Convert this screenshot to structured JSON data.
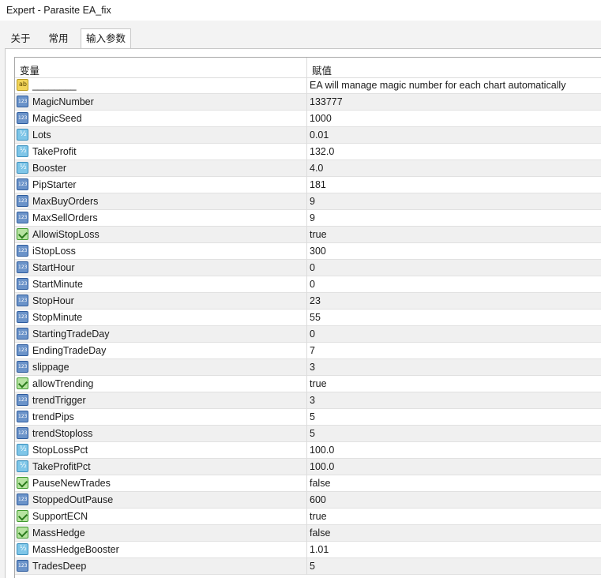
{
  "window": {
    "title": "Expert - Parasite EA_fix"
  },
  "tabs": [
    {
      "label": "关于"
    },
    {
      "label": "常用"
    },
    {
      "label": "输入参数",
      "active": true
    }
  ],
  "table": {
    "headers": {
      "variable": "变量",
      "value": "赋值"
    },
    "rows": [
      {
        "icon": "string-icon",
        "name": "________",
        "value": "EA will manage magic number for each chart automatically"
      },
      {
        "icon": "integer-icon",
        "name": "MagicNumber",
        "value": "133777"
      },
      {
        "icon": "integer-icon",
        "name": "MagicSeed",
        "value": "1000"
      },
      {
        "icon": "double-icon",
        "name": "Lots",
        "value": "0.01"
      },
      {
        "icon": "double-icon",
        "name": "TakeProfit",
        "value": "132.0"
      },
      {
        "icon": "double-icon",
        "name": "Booster",
        "value": "4.0"
      },
      {
        "icon": "integer-icon",
        "name": "PipStarter",
        "value": "181"
      },
      {
        "icon": "integer-icon",
        "name": "MaxBuyOrders",
        "value": "9"
      },
      {
        "icon": "integer-icon",
        "name": "MaxSellOrders",
        "value": "9"
      },
      {
        "icon": "bool-icon",
        "name": "AllowiStopLoss",
        "value": "true"
      },
      {
        "icon": "integer-icon",
        "name": "iStopLoss",
        "value": "300"
      },
      {
        "icon": "integer-icon",
        "name": "StartHour",
        "value": "0"
      },
      {
        "icon": "integer-icon",
        "name": "StartMinute",
        "value": "0"
      },
      {
        "icon": "integer-icon",
        "name": "StopHour",
        "value": "23"
      },
      {
        "icon": "integer-icon",
        "name": "StopMinute",
        "value": "55"
      },
      {
        "icon": "integer-icon",
        "name": "StartingTradeDay",
        "value": "0"
      },
      {
        "icon": "integer-icon",
        "name": "EndingTradeDay",
        "value": "7"
      },
      {
        "icon": "integer-icon",
        "name": "slippage",
        "value": "3"
      },
      {
        "icon": "bool-icon",
        "name": "allowTrending",
        "value": "true"
      },
      {
        "icon": "integer-icon",
        "name": "trendTrigger",
        "value": "3"
      },
      {
        "icon": "integer-icon",
        "name": "trendPips",
        "value": "5"
      },
      {
        "icon": "integer-icon",
        "name": "trendStoploss",
        "value": "5"
      },
      {
        "icon": "double-icon",
        "name": "StopLossPct",
        "value": "100.0"
      },
      {
        "icon": "double-icon",
        "name": "TakeProfitPct",
        "value": "100.0"
      },
      {
        "icon": "bool-icon",
        "name": "PauseNewTrades",
        "value": "false"
      },
      {
        "icon": "integer-icon",
        "name": "StoppedOutPause",
        "value": "600"
      },
      {
        "icon": "bool-icon",
        "name": "SupportECN",
        "value": "true"
      },
      {
        "icon": "bool-icon",
        "name": "MassHedge",
        "value": "false"
      },
      {
        "icon": "double-icon",
        "name": "MassHedgeBooster",
        "value": "1.01"
      },
      {
        "icon": "integer-icon",
        "name": "TradesDeep",
        "value": "5"
      }
    ]
  }
}
